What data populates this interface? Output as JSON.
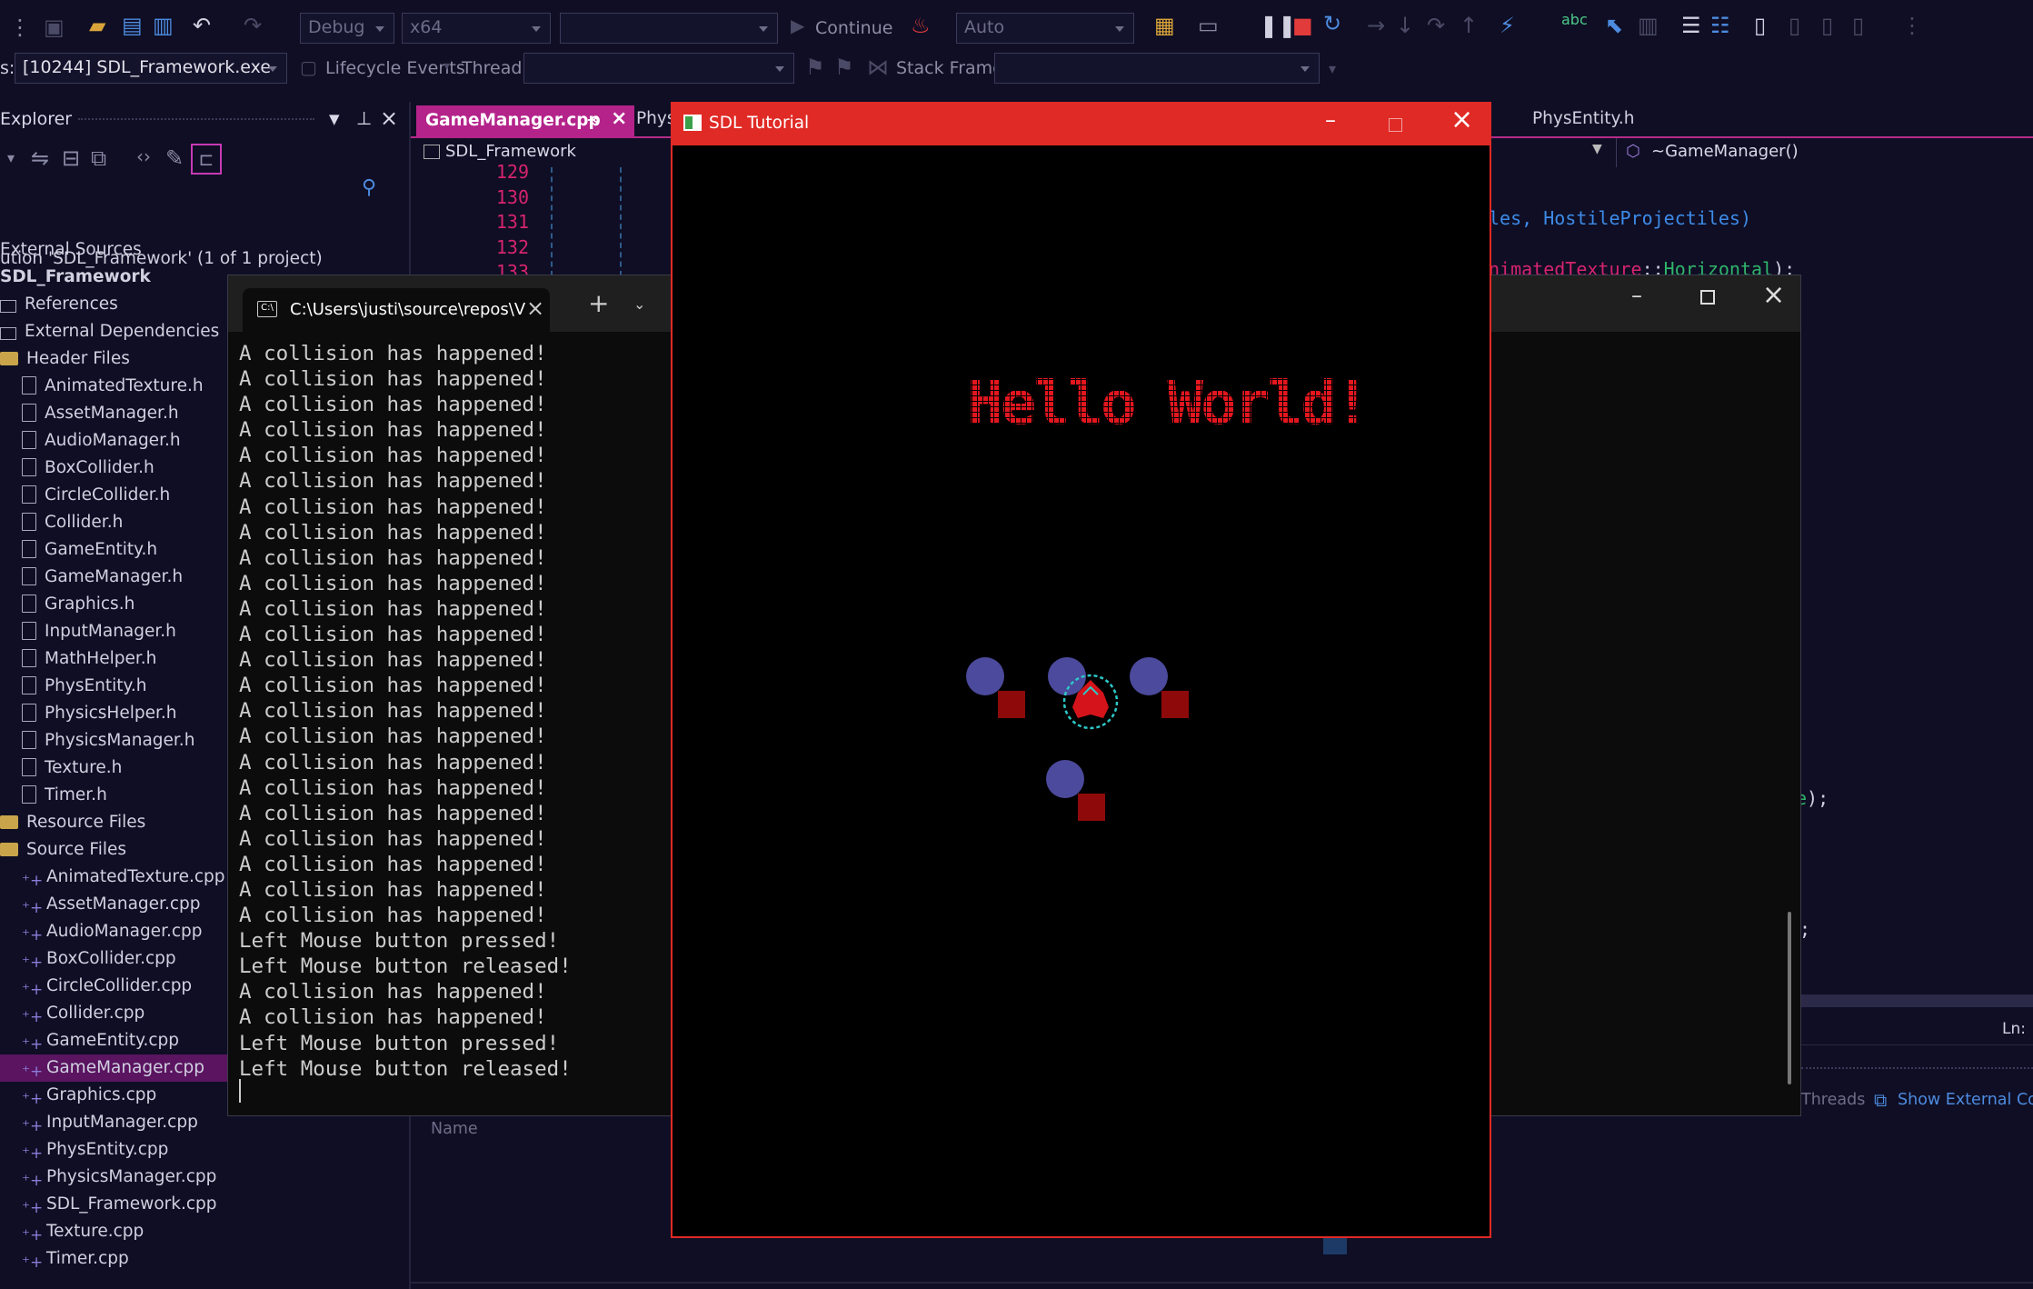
{
  "toolbar": {
    "config": "Debug",
    "platform": "x64",
    "target": "",
    "continue_label": "Continue",
    "auto": "Auto"
  },
  "debug_bar": {
    "process": "[10244] SDL_Framework.exe",
    "process_prefix": "s:",
    "lifecycle": "Lifecycle Events",
    "thread_label": "Thread:",
    "stack_label": "Stack Frame:"
  },
  "solution_explorer": {
    "title": "Explorer",
    "solution": "ution 'SDL_Framework' (1 of 1 project)",
    "items": [
      {
        "label": "External Sources",
        "indent": 0,
        "icon": "none"
      },
      {
        "label": "SDL_Framework",
        "indent": 0,
        "icon": "none",
        "bold": true
      },
      {
        "label": "References",
        "indent": 0,
        "icon": "ref"
      },
      {
        "label": "External Dependencies",
        "indent": 0,
        "icon": "ref"
      },
      {
        "label": "Header Files",
        "indent": 0,
        "icon": "folder"
      },
      {
        "label": "AnimatedTexture.h",
        "indent": 1,
        "icon": "file"
      },
      {
        "label": "AssetManager.h",
        "indent": 1,
        "icon": "file"
      },
      {
        "label": "AudioManager.h",
        "indent": 1,
        "icon": "file"
      },
      {
        "label": "BoxCollider.h",
        "indent": 1,
        "icon": "file"
      },
      {
        "label": "CircleCollider.h",
        "indent": 1,
        "icon": "file"
      },
      {
        "label": "Collider.h",
        "indent": 1,
        "icon": "file"
      },
      {
        "label": "GameEntity.h",
        "indent": 1,
        "icon": "file"
      },
      {
        "label": "GameManager.h",
        "indent": 1,
        "icon": "file"
      },
      {
        "label": "Graphics.h",
        "indent": 1,
        "icon": "file"
      },
      {
        "label": "InputManager.h",
        "indent": 1,
        "icon": "file"
      },
      {
        "label": "MathHelper.h",
        "indent": 1,
        "icon": "file"
      },
      {
        "label": "PhysEntity.h",
        "indent": 1,
        "icon": "file"
      },
      {
        "label": "PhysicsHelper.h",
        "indent": 1,
        "icon": "file"
      },
      {
        "label": "PhysicsManager.h",
        "indent": 1,
        "icon": "file"
      },
      {
        "label": "Texture.h",
        "indent": 1,
        "icon": "file"
      },
      {
        "label": "Timer.h",
        "indent": 1,
        "icon": "file"
      },
      {
        "label": "Resource Files",
        "indent": 0,
        "icon": "folder"
      },
      {
        "label": "Source Files",
        "indent": 0,
        "icon": "folder"
      },
      {
        "label": "AnimatedTexture.cpp",
        "indent": 1,
        "icon": "cpp"
      },
      {
        "label": "AssetManager.cpp",
        "indent": 1,
        "icon": "cpp"
      },
      {
        "label": "AudioManager.cpp",
        "indent": 1,
        "icon": "cpp"
      },
      {
        "label": "BoxCollider.cpp",
        "indent": 1,
        "icon": "cpp"
      },
      {
        "label": "CircleCollider.cpp",
        "indent": 1,
        "icon": "cpp"
      },
      {
        "label": "Collider.cpp",
        "indent": 1,
        "icon": "cpp"
      },
      {
        "label": "GameEntity.cpp",
        "indent": 1,
        "icon": "cpp"
      },
      {
        "label": "GameManager.cpp",
        "indent": 1,
        "icon": "cpp",
        "selected": true
      },
      {
        "label": "Graphics.cpp",
        "indent": 1,
        "icon": "cpp"
      },
      {
        "label": "InputManager.cpp",
        "indent": 1,
        "icon": "cpp"
      },
      {
        "label": "PhysEntity.cpp",
        "indent": 1,
        "icon": "cpp"
      },
      {
        "label": "PhysicsManager.cpp",
        "indent": 1,
        "icon": "cpp"
      },
      {
        "label": "SDL_Framework.cpp",
        "indent": 1,
        "icon": "cpp"
      },
      {
        "label": "Texture.cpp",
        "indent": 1,
        "icon": "cpp"
      },
      {
        "label": "Timer.cpp",
        "indent": 1,
        "icon": "cpp"
      }
    ]
  },
  "editor": {
    "active_tab": "GameManager.cpp",
    "tab2": "Phys",
    "tab_right": "PhysEntity.h",
    "project_combo": "SDL_Framework",
    "member_combo": "~GameManager()",
    "line_numbers": [
      "129",
      "130",
      "131",
      "132",
      "133"
    ],
    "code_right_1": "les, HostileProjectiles)",
    "code_right_2_a": "nimatedTexture",
    "code_right_2_b": "::",
    "code_right_2_c": "Horizontal",
    "code_right_2_d": ");",
    "code_right_3": "e);",
    "code_right_4": ";",
    "line_indicator": "Ln:",
    "threads_label": "Threads",
    "show_external": "Show External Co",
    "name_header": "Name"
  },
  "terminal": {
    "tab_title": "C:\\Users\\justi\\source\\repos\\V",
    "lines": [
      "A collision has happened!",
      "A collision has happened!",
      "A collision has happened!",
      "A collision has happened!",
      "A collision has happened!",
      "A collision has happened!",
      "A collision has happened!",
      "A collision has happened!",
      "A collision has happened!",
      "A collision has happened!",
      "A collision has happened!",
      "A collision has happened!",
      "A collision has happened!",
      "A collision has happened!",
      "A collision has happened!",
      "A collision has happened!",
      "A collision has happened!",
      "A collision has happened!",
      "A collision has happened!",
      "A collision has happened!",
      "A collision has happened!",
      "A collision has happened!",
      "A collision has happened!",
      "Left Mouse button pressed!",
      "Left Mouse button released!",
      "A collision has happened!",
      "A collision has happened!",
      "Left Mouse button pressed!",
      "Left Mouse button released!"
    ]
  },
  "sdl_window": {
    "title": "SDL Tutorial",
    "hello": "Hello World!",
    "colors": {
      "frame": "#e02a25",
      "text": "#e3161e",
      "circle": "#4b4a9c",
      "square": "#8e0a0a"
    }
  }
}
